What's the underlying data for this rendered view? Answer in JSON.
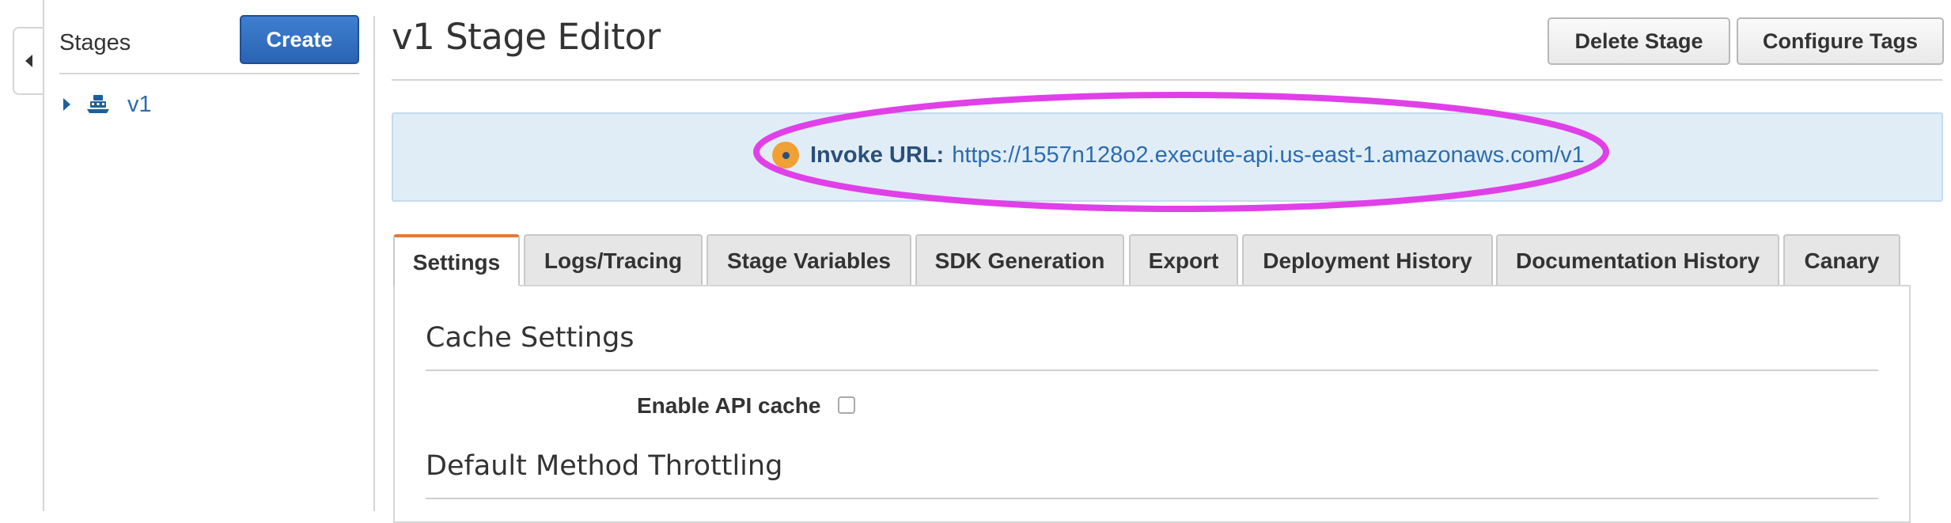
{
  "sidebar": {
    "title": "Stages",
    "create_label": "Create",
    "items": [
      {
        "label": "v1"
      }
    ]
  },
  "header": {
    "title": "v1 Stage Editor",
    "delete_label": "Delete Stage",
    "tags_label": "Configure Tags"
  },
  "invoke": {
    "label": "Invoke URL:",
    "url": "https://1557n128o2.execute-api.us-east-1.amazonaws.com/v1"
  },
  "tabs": [
    {
      "label": "Settings",
      "active": true
    },
    {
      "label": "Logs/Tracing"
    },
    {
      "label": "Stage Variables"
    },
    {
      "label": "SDK Generation"
    },
    {
      "label": "Export"
    },
    {
      "label": "Deployment History"
    },
    {
      "label": "Documentation History"
    },
    {
      "label": "Canary"
    }
  ],
  "settings": {
    "cache_title": "Cache Settings",
    "enable_cache_label": "Enable API cache",
    "enable_cache_checked": false,
    "throttling_title": "Default Method Throttling"
  },
  "colors": {
    "primary_button": "#2a64b3",
    "active_tab_accent": "#e07b39",
    "banner_background": "#e1edf6",
    "highlight": "#e040e8"
  }
}
